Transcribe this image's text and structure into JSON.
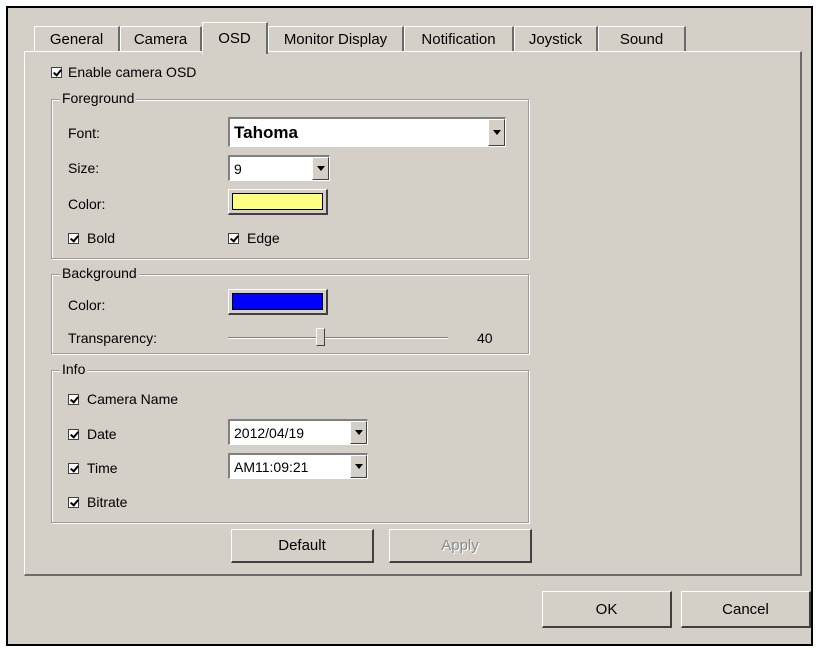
{
  "tabs": [
    {
      "label": "General"
    },
    {
      "label": "Camera"
    },
    {
      "label": "OSD",
      "active": true
    },
    {
      "label": "Monitor Display"
    },
    {
      "label": "Notification"
    },
    {
      "label": "Joystick"
    },
    {
      "label": "Sound"
    }
  ],
  "osd": {
    "enable_label": "Enable camera OSD",
    "enable_checked": true
  },
  "foreground": {
    "legend": "Foreground",
    "font_label": "Font:",
    "font_value": "Tahoma",
    "size_label": "Size:",
    "size_value": "9",
    "color_label": "Color:",
    "color_value": "#ffff80",
    "bold_label": "Bold",
    "bold_checked": true,
    "edge_label": "Edge",
    "edge_checked": true
  },
  "background": {
    "legend": "Background",
    "color_label": "Color:",
    "color_value": "#0000ff",
    "transparency_label": "Transparency:",
    "transparency_value": "40",
    "transparency_fraction": 0.4
  },
  "info": {
    "legend": "Info",
    "camera_name_label": "Camera Name",
    "camera_name_checked": true,
    "date_label": "Date",
    "date_checked": true,
    "date_format": "2012/04/19",
    "time_label": "Time",
    "time_checked": true,
    "time_format": "AM11:09:21",
    "bitrate_label": "Bitrate",
    "bitrate_checked": true
  },
  "buttons": {
    "default_label": "Default",
    "apply_label": "Apply",
    "ok_label": "OK",
    "cancel_label": "Cancel"
  }
}
